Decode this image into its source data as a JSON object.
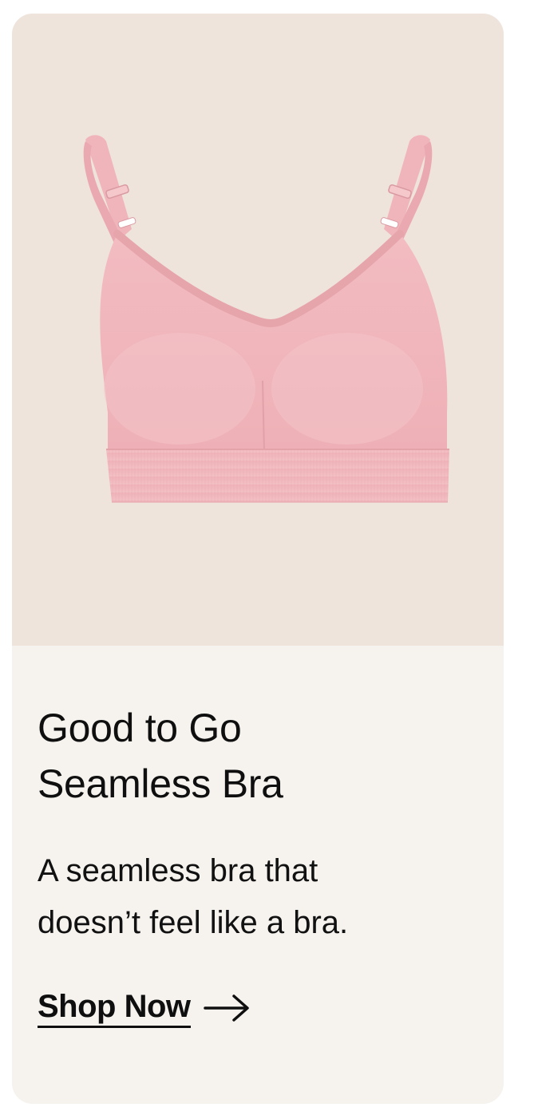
{
  "product": {
    "image_alt": "Pink seamless bra",
    "title_line1": "Good to Go",
    "title_line2": "Seamless Bra",
    "description_line1": "A seamless bra that",
    "description_line2": "doesn’t feel like a bra.",
    "cta_label": "Shop Now",
    "cta_icon": "arrow-right-icon"
  },
  "colors": {
    "card_background": "#f6f2ee",
    "image_background": "#efe4dc",
    "product_pink": "#f2b8bc",
    "text": "#0f0f0f"
  }
}
